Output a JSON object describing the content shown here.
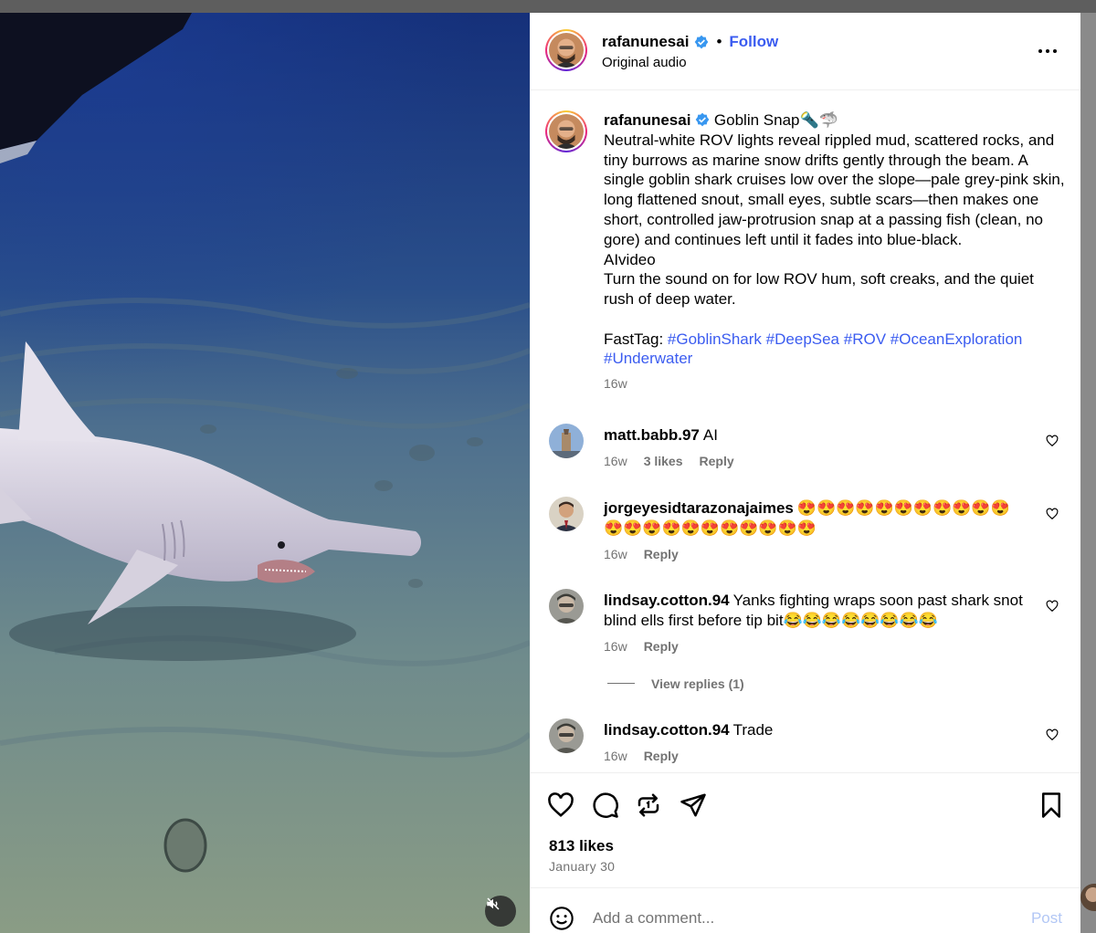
{
  "header": {
    "username": "rafanunesai",
    "follow_label": "Follow",
    "audio_label": "Original audio",
    "separator": "•"
  },
  "caption": {
    "username": "rafanunesai",
    "text": "Goblin Snap🔦🦈\nNeutral-white ROV lights reveal rippled mud, scattered rocks, and tiny burrows as marine snow drifts gently through the beam. A single goblin shark cruises low over the slope—pale grey-pink skin, long flattened snout, small eyes, subtle scars—then makes one short, controlled jaw-protrusion snap at a passing fish (clean, no gore) and continues left until it fades into blue-black.\nAIvideo\nTurn the sound on for low ROV hum, soft creaks, and the quiet rush of deep water.\n\nFastTag: ",
    "tags": [
      "#GoblinShark",
      "#DeepSea",
      "#ROV",
      "#OceanExploration",
      "#Underwater"
    ],
    "time": "16w"
  },
  "comments": [
    {
      "username": "matt.babb.97",
      "text": "AI",
      "time": "16w",
      "likes": "3 likes",
      "reply_label": "Reply"
    },
    {
      "username": "jorgeyesidtarazonajaimes",
      "text": "😍😍😍😍😍😍😍😍😍😍😍😍😍😍😍😍😍😍😍😍😍😍",
      "time": "16w",
      "reply_label": "Reply"
    },
    {
      "username": "lindsay.cotton.94",
      "text": "Yanks fighting wraps soon past shark snot blind ells first before tip bit😂😂😂😂😂😂😂😂",
      "time": "16w",
      "reply_label": "Reply",
      "view_replies": "View replies (1)"
    },
    {
      "username": "lindsay.cotton.94",
      "text": "Trade",
      "time": "16w",
      "reply_label": "Reply"
    }
  ],
  "actions": {
    "icons": [
      "heart-icon",
      "comment-icon",
      "repost-icon",
      "share-icon",
      "bookmark-icon"
    ],
    "likes": "813 likes",
    "date": "January 30"
  },
  "comment_box": {
    "placeholder": "Add a comment...",
    "post_label": "Post"
  },
  "colors": {
    "link": "#3b5cf0",
    "muted": "#737373",
    "verified": "#3897f0",
    "post_disabled": "#b2c7f5"
  }
}
